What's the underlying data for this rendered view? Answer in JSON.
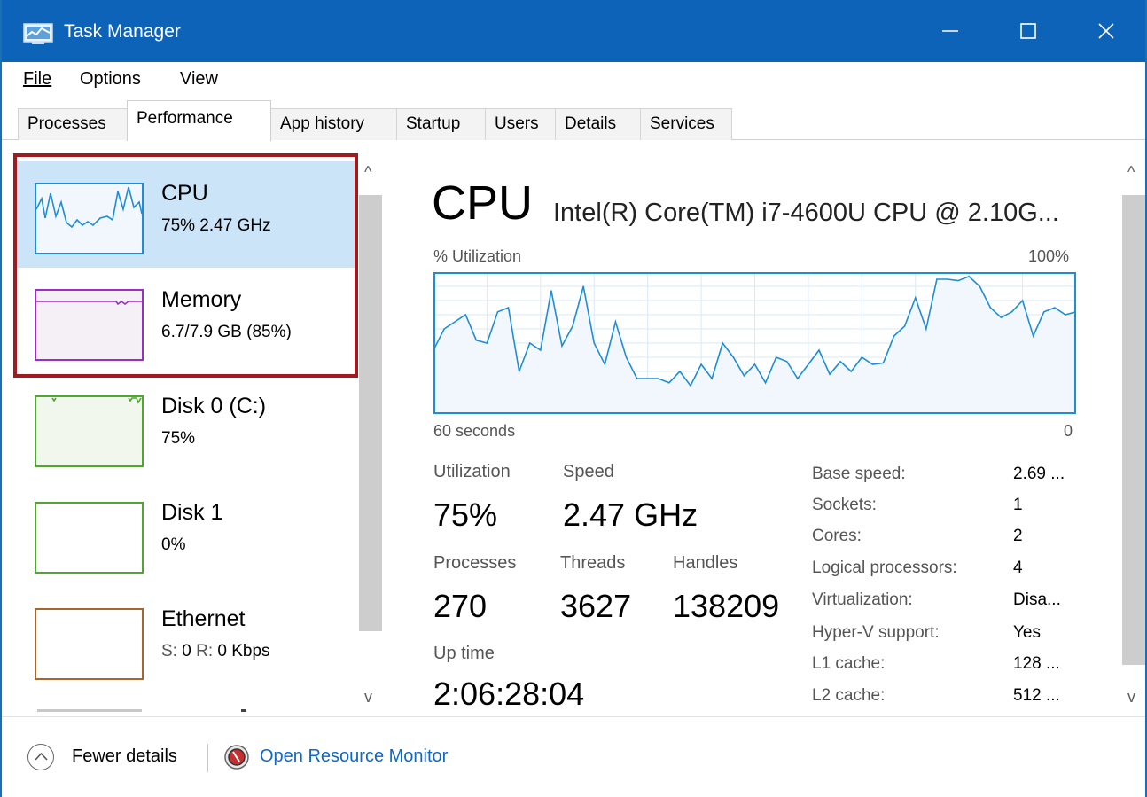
{
  "window": {
    "title": "Task Manager",
    "accent": "#0d63b8",
    "controls": [
      "minimize-icon",
      "maximize-icon",
      "close-icon"
    ]
  },
  "menu": {
    "file": "File",
    "options": "Options",
    "view": "View"
  },
  "tabs": {
    "processes": "Processes",
    "performance": "Performance",
    "app_history": "App history",
    "startup": "Startup",
    "users": "Users",
    "details": "Details",
    "services": "Services",
    "active": "Performance"
  },
  "resources": [
    {
      "name": "CPU",
      "sub": "75% 2.47 GHz",
      "color": "#1f8dd6",
      "selected": true
    },
    {
      "name": "Memory",
      "sub": "6.7/7.9 GB (85%)",
      "color": "#9b2ec0",
      "selected": false
    },
    {
      "name": "Disk 0 (C:)",
      "sub": "75%",
      "color": "#4ea72f",
      "selected": false
    },
    {
      "name": "Disk 1",
      "sub": "0%",
      "color": "#4ea72f",
      "selected": false
    },
    {
      "name": "Ethernet",
      "sub_prefix_s": "S:",
      "sub_s": "0",
      "sub_prefix_r": "R:",
      "sub_r": "0 Kbps",
      "color": "#a7662b",
      "selected": false
    }
  ],
  "detail": {
    "title": "CPU",
    "model": "Intel(R) Core(TM) i7-4600U CPU @ 2.10G...",
    "graph_label": "% Utilization",
    "graph_max": "100%",
    "graph_time": "60 seconds",
    "graph_zero": "0",
    "graph_color": "#1f8dd6"
  },
  "chart_data": {
    "type": "area",
    "x": [
      0,
      1,
      2,
      3,
      4,
      5,
      6,
      7,
      8,
      9,
      10,
      11,
      12,
      13,
      14,
      15,
      16,
      17,
      18,
      19,
      20,
      21,
      22,
      23,
      24,
      25,
      26,
      27,
      28,
      29,
      30,
      31,
      32,
      33,
      34,
      35,
      36,
      37,
      38,
      39,
      40,
      41,
      42,
      43,
      44,
      45,
      46,
      47,
      48,
      49,
      50,
      51,
      52,
      53,
      54,
      55,
      56,
      57,
      58,
      59,
      60
    ],
    "values": [
      45,
      60,
      65,
      70,
      52,
      50,
      72,
      75,
      30,
      50,
      45,
      87,
      48,
      62,
      90,
      50,
      35,
      65,
      40,
      25,
      25,
      25,
      22,
      30,
      20,
      35,
      25,
      50,
      40,
      27,
      35,
      22,
      40,
      37,
      25,
      35,
      45,
      28,
      37,
      30,
      40,
      35,
      36,
      55,
      62,
      82,
      60,
      95,
      95,
      94,
      97,
      90,
      75,
      68,
      72,
      80,
      55,
      72,
      75,
      70,
      72
    ],
    "ylim": [
      0,
      100
    ],
    "xlabel": "60 seconds",
    "ylabel": "% Utilization"
  },
  "stats": {
    "utilization_label": "Utilization",
    "utilization_value": "75%",
    "speed_label": "Speed",
    "speed_value": "2.47 GHz",
    "processes_label": "Processes",
    "processes_value": "270",
    "threads_label": "Threads",
    "threads_value": "3627",
    "handles_label": "Handles",
    "handles_value": "138209",
    "uptime_label": "Up time",
    "uptime_value": "2:06:28:04"
  },
  "specs": [
    {
      "label": "Base speed:",
      "value": "2.69 ..."
    },
    {
      "label": "Sockets:",
      "value": "1"
    },
    {
      "label": "Cores:",
      "value": "2"
    },
    {
      "label": "Logical processors:",
      "value": "4"
    },
    {
      "label": "Virtualization:",
      "value": "Disa..."
    },
    {
      "label": "Hyper-V support:",
      "value": "Yes"
    },
    {
      "label": "L1 cache:",
      "value": "128 ..."
    },
    {
      "label": "L2 cache:",
      "value": "512 ..."
    }
  ],
  "footer": {
    "fewer_details": "Fewer details",
    "open_monitor": "Open Resource Monitor"
  }
}
